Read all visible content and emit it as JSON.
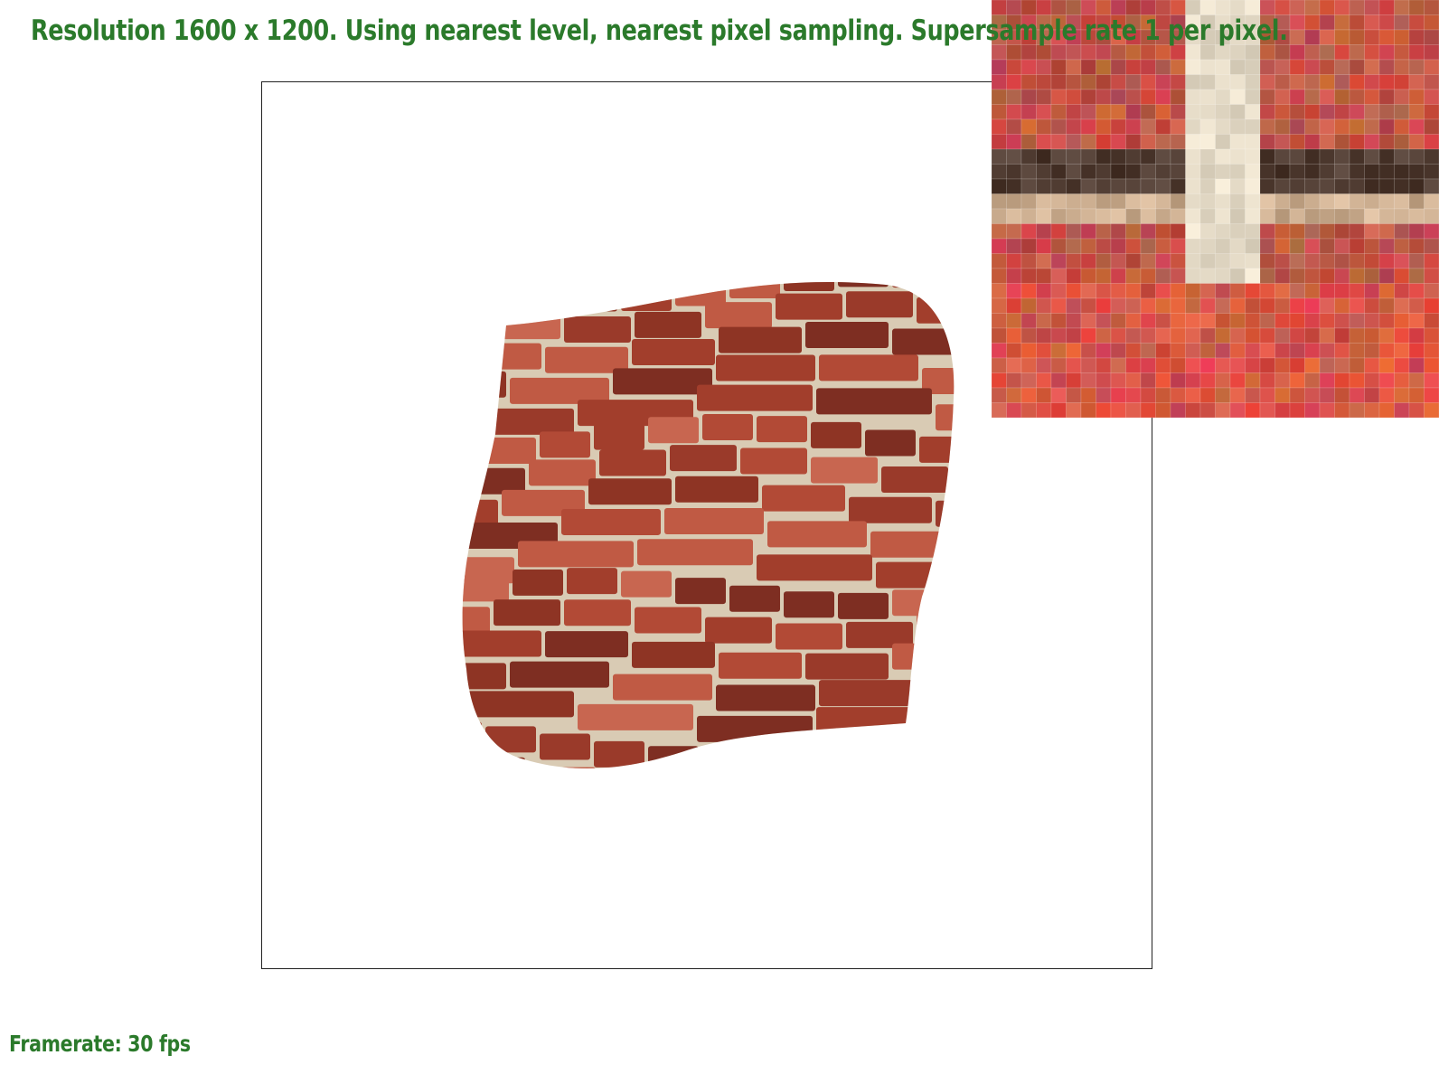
{
  "app": {
    "status_line": "Resolution 1600 x 1200. Using nearest level, nearest pixel sampling. Supersample rate 1 per pixel.",
    "framerate_text": "Framerate: 30 fps"
  },
  "colors": {
    "status_text": "#2b7a2b",
    "brick_dark": "#8e3424",
    "brick_mid": "#b24a36",
    "brick_light": "#c86650",
    "mortar": "#d9cbb4",
    "inset_mortar_dark": "#3a1d14"
  },
  "render": {
    "sampling_level": "nearest level",
    "pixel_sampling": "nearest pixel",
    "supersample_rate": 1,
    "subject": "brick-wall-texture"
  }
}
